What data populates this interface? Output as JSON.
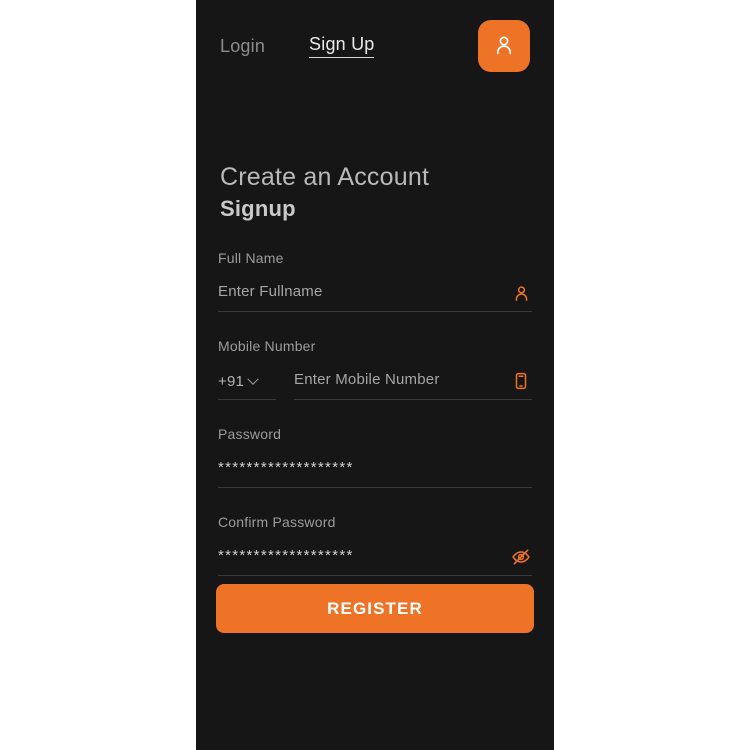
{
  "theme": {
    "accent": "#ee7326",
    "panel_bg": "#161616",
    "page_bg": "#ffffff",
    "label_color": "#9c9c9c",
    "underline_color": "#3a3a3a"
  },
  "nav": {
    "login_label": "Login",
    "signup_label": "Sign Up",
    "avatar_icon": "user-icon"
  },
  "heading": {
    "line1": "Create an Account",
    "line2": "Signup"
  },
  "form": {
    "fields": [
      {
        "label": "Full Name",
        "placeholder": "Enter Fullname",
        "value": "",
        "icon": "user-icon"
      },
      {
        "label": "Mobile Number",
        "country_code": "+91",
        "country_code_icon": "chevron-down-icon",
        "placeholder": "Enter Mobile Number",
        "value": "",
        "icon": "smartphone-icon"
      },
      {
        "label": "Password",
        "placeholder": "",
        "value": "*******************",
        "icon": ""
      },
      {
        "label": "Confirm Password",
        "placeholder": "",
        "value": "*******************",
        "icon": "eye-off-icon"
      }
    ]
  },
  "submit": {
    "label": "REGISTER"
  }
}
